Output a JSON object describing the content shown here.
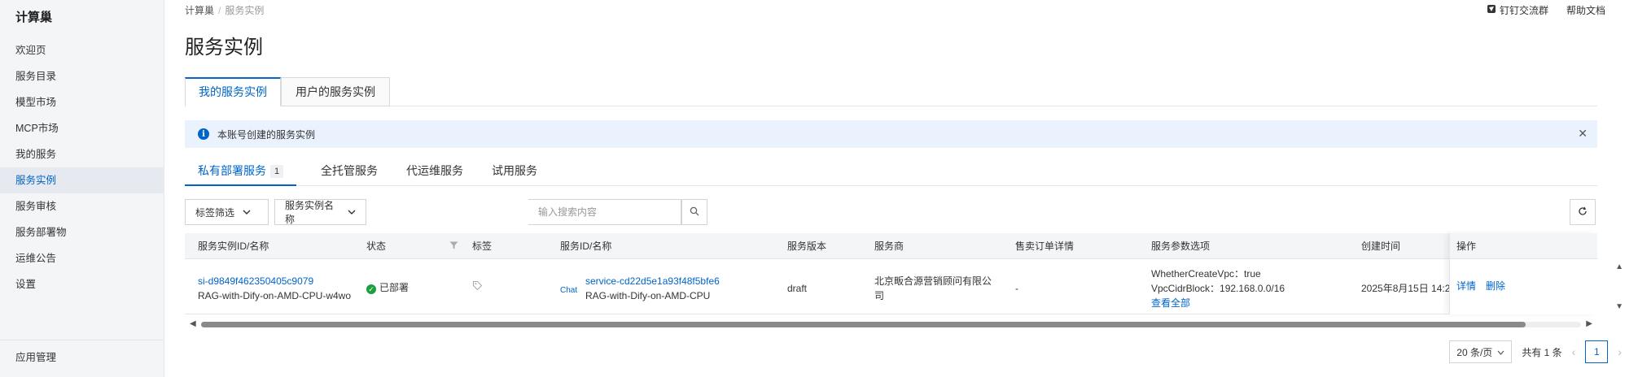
{
  "sidebar": {
    "title": "计算巢",
    "items": [
      {
        "label": "欢迎页"
      },
      {
        "label": "服务目录"
      },
      {
        "label": "模型市场"
      },
      {
        "label": "MCP市场"
      },
      {
        "label": "我的服务"
      },
      {
        "label": "服务实例"
      },
      {
        "label": "服务审核"
      },
      {
        "label": "服务部署物"
      },
      {
        "label": "运维公告"
      },
      {
        "label": "设置"
      }
    ],
    "active_index": 5,
    "bottom_item": "应用管理"
  },
  "breadcrumb": [
    "计算巢",
    "服务实例"
  ],
  "top_links": {
    "dingtalk": "钉钉交流群",
    "help": "帮助文档"
  },
  "page_title": "服务实例",
  "tabs": [
    {
      "label": "我的服务实例",
      "active": true
    },
    {
      "label": "用户的服务实例",
      "active": false
    }
  ],
  "alert": {
    "text": "本账号创建的服务实例"
  },
  "subtabs": [
    {
      "label": "私有部署服务",
      "badge": "1",
      "active": true
    },
    {
      "label": "全托管服务"
    },
    {
      "label": "代运维服务"
    },
    {
      "label": "试用服务"
    }
  ],
  "filters": {
    "tag_filter": "标签筛选",
    "field_select": "服务实例名称",
    "search_placeholder": "输入搜索内容"
  },
  "table": {
    "columns": [
      "服务实例ID/名称",
      "状态",
      "标签",
      "服务ID/名称",
      "服务版本",
      "服务商",
      "售卖订单详情",
      "服务参数选项",
      "创建时间",
      "操作"
    ],
    "rows": [
      {
        "instance_id": "si-d9849f462350405c9079",
        "instance_name": "RAG-with-Dify-on-AMD-CPU-w4wo",
        "status": "已部署",
        "service_tag": "Chat",
        "service_id": "service-cd22d5e1a93f48f5bfe6",
        "service_name": "RAG-with-Dify-on-AMD-CPU",
        "version": "draft",
        "provider_line1": "北京畈合源营销顾问有限公",
        "provider_line2": "司",
        "order_detail": "-",
        "param_1": "WhetherCreateVpc：true",
        "param_2": "VpcCidrBlock：192.168.0.0/16",
        "param_more": "查看全部",
        "created": "2025年8月15日 14:2",
        "action_detail": "详情",
        "action_delete": "删除"
      }
    ]
  },
  "pagination": {
    "page_size": "20 条/页",
    "total": "共有 1 条",
    "current_page": "1"
  },
  "colors": {
    "accent": "#0064c8",
    "success": "#1e9e3e",
    "alert_bg": "#eaf3fd"
  }
}
